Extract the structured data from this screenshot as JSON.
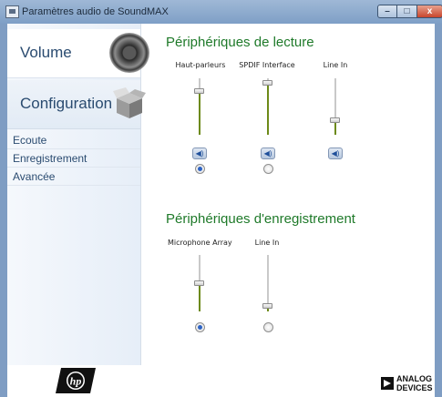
{
  "window": {
    "title": "Paramètres audio de SoundMAX",
    "buttons": {
      "minimize": "–",
      "maximize": "□",
      "close": "x"
    }
  },
  "sidebar": {
    "volume_label": "Volume",
    "configuration_label": "Configuration",
    "items": [
      {
        "label": "Ecoute"
      },
      {
        "label": "Enregistrement"
      },
      {
        "label": "Avancée"
      }
    ],
    "icons": {
      "volume": "speaker-icon",
      "configuration": "box-icon"
    }
  },
  "playback": {
    "title": "Périphériques de lecture",
    "devices": [
      {
        "label": "Haut-parleurs",
        "volume_level": 0.8,
        "default": true
      },
      {
        "label": "SPDIF Interface",
        "volume_level": 1.0,
        "default": false
      },
      {
        "label": "Line In",
        "volume_level": 0.3,
        "default": null
      }
    ]
  },
  "recording": {
    "title": "Périphériques d'enregistrement",
    "devices": [
      {
        "label": "Microphone Array",
        "volume_level": 0.5,
        "default": true
      },
      {
        "label": "Line In",
        "volume_level": 0.1,
        "default": false
      }
    ]
  },
  "logos": {
    "left": "hp-logo",
    "right_text_line1": "ANALOG",
    "right_text_line2": "DEVICES"
  },
  "colors": {
    "section_title": "#1f7a2a",
    "slider_fill": "#6d8a19",
    "sidebar_text": "#2a4b70"
  }
}
